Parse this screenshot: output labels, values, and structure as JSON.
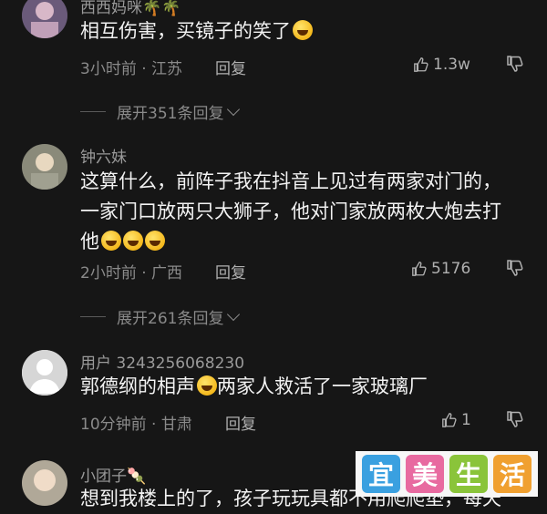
{
  "comments": [
    {
      "name": "西西妈咪🌴🌴",
      "text_lines": [
        "相互伤害，买镜子的笑了"
      ],
      "emoji_count": 1,
      "time": "3小时前 · 江苏",
      "reply_label": "回复",
      "likes": "1.3w",
      "expand": "展开351条回复"
    },
    {
      "name": "钟六妹",
      "text_lines": [
        "这算什么，前阵子我在抖音上见过有两家对门的，",
        "一家门口放两只大狮子，他对门家放两枚大炮去打",
        "他"
      ],
      "emoji_count": 3,
      "time": "2小时前 · 广西",
      "reply_label": "回复",
      "likes": "5176",
      "expand": "展开261条回复"
    },
    {
      "name": "用户 3243256068230",
      "text_lines": [
        "郭德纲的相声",
        "两家人救活了一家玻璃厂"
      ],
      "emoji_count": 1,
      "time": "10分钟前 · 甘肃",
      "reply_label": "回复",
      "likes": "1"
    },
    {
      "name": "小团子🍡",
      "text_lines": [
        "想到我楼上的了，孩子玩玩具都不用爬爬垫，每天"
      ]
    }
  ],
  "watermark": {
    "chars": [
      "宜",
      "美",
      "生",
      "活"
    ],
    "colors": [
      "#3aa0e0",
      "#e86aa0",
      "#8ac43a",
      "#f0a030"
    ]
  }
}
